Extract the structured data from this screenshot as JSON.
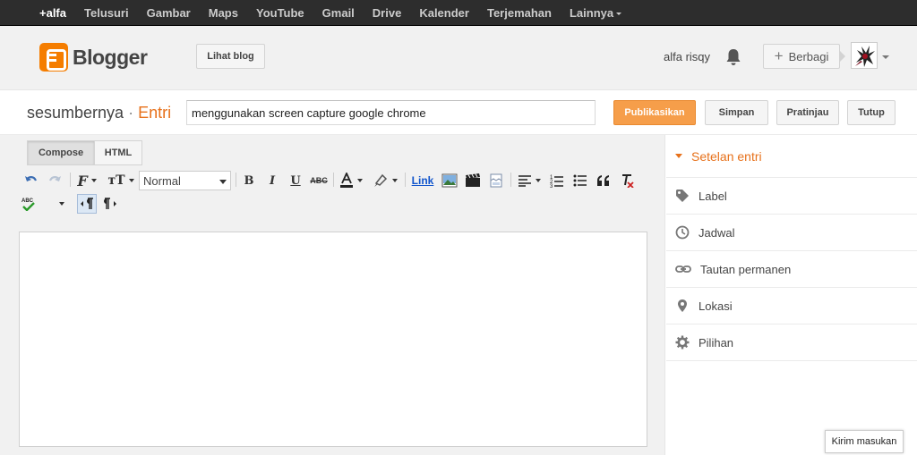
{
  "gbar": {
    "items": [
      "+alfa",
      "Telusuri",
      "Gambar",
      "Maps",
      "YouTube",
      "Gmail",
      "Drive",
      "Kalender",
      "Terjemahan",
      "Lainnya"
    ]
  },
  "header": {
    "logo_text": "Blogger",
    "view_blog": "Lihat blog",
    "user_name": "alfa risqy",
    "share_label": "Berbagi",
    "share_plus": "+"
  },
  "post": {
    "blog_name": "sesumbernya",
    "separator": "·",
    "section": "Entri",
    "title_value": "menggunakan screen capture google chrome",
    "publish": "Publikasikan",
    "save": "Simpan",
    "preview": "Pratinjau",
    "close": "Tutup"
  },
  "editor": {
    "tab_compose": "Compose",
    "tab_html": "HTML",
    "format_value": "Normal",
    "link_label": "Link"
  },
  "sidebar": {
    "heading": "Setelan entri",
    "items": [
      "Label",
      "Jadwal",
      "Tautan permanen",
      "Lokasi",
      "Pilihan"
    ]
  },
  "feedback": "Kirim masukan",
  "colors": {
    "accent_orange": "#f57d00",
    "publish_button": "#f69e4a",
    "gbar_bg": "#2d2d2d"
  }
}
